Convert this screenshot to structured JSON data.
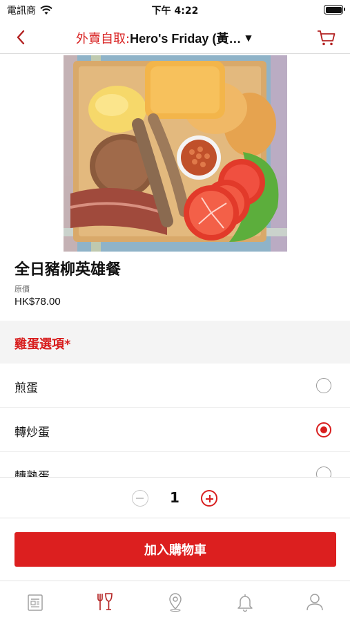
{
  "status_bar": {
    "carrier": "電訊商",
    "time": "下午 4:22"
  },
  "nav": {
    "order_mode": "外賣自取:",
    "store_name": "Hero's Friday (黃…",
    "caret": "▼"
  },
  "product": {
    "name": "全日豬柳英雄餐",
    "price_label": "原價",
    "price": "HK$78.00"
  },
  "egg_options": {
    "title": "雞蛋選項*",
    "options": [
      {
        "label": "煎蛋",
        "selected": false
      },
      {
        "label": "轉炒蛋",
        "selected": true
      },
      {
        "label": "轉熟蛋",
        "selected": false
      }
    ]
  },
  "quantity": {
    "value": "1"
  },
  "add_to_cart_label": "加入購物車",
  "tab_bar": {
    "items": [
      {
        "icon": "news-icon",
        "active": false
      },
      {
        "icon": "dining-icon",
        "active": true
      },
      {
        "icon": "location-pin-icon",
        "active": false
      },
      {
        "icon": "bell-icon",
        "active": false
      },
      {
        "icon": "profile-icon",
        "active": false
      }
    ]
  },
  "colors": {
    "accent": "#dc1f1f",
    "inactive_icon": "#a0a0a0",
    "section_bg": "#f4f4f4"
  }
}
